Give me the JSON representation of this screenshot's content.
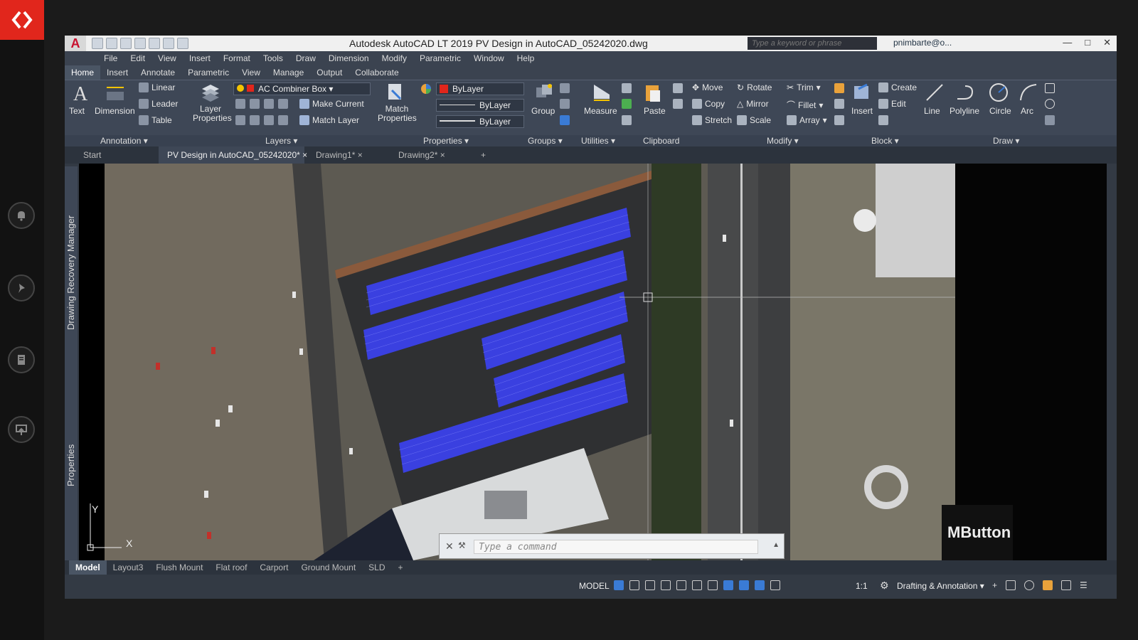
{
  "window": {
    "title": "Autodesk AutoCAD LT 2019    PV Design in AutoCAD_05242020.dwg",
    "search_placeholder": "Type a keyword or phrase",
    "user": "pnimbarte@o...",
    "app_badge": "A"
  },
  "menu": [
    "File",
    "Edit",
    "View",
    "Insert",
    "Format",
    "Tools",
    "Draw",
    "Dimension",
    "Modify",
    "Parametric",
    "Window",
    "Help"
  ],
  "ribbon_tabs": [
    "Home",
    "Insert",
    "Annotate",
    "Parametric",
    "View",
    "Manage",
    "Output",
    "Collaborate"
  ],
  "annotation": {
    "text": "Text",
    "dimension": "Dimension",
    "linear": "Linear",
    "leader": "Leader",
    "table": "Table",
    "title": "Annotation"
  },
  "layers": {
    "layer_properties": "Layer Properties",
    "current_layer": "AC Combiner Box",
    "make_current": "Make Current",
    "match_layer": "Match Layer",
    "title": "Layers"
  },
  "properties": {
    "match_properties": "Match Properties",
    "color": "ByLayer",
    "linetype": "ByLayer",
    "lineweight": "ByLayer",
    "title": "Properties"
  },
  "groups": {
    "group": "Group",
    "title": "Groups"
  },
  "utilities": {
    "measure": "Measure",
    "title": "Utilities"
  },
  "clipboard": {
    "paste": "Paste",
    "title": "Clipboard"
  },
  "modify": {
    "move": "Move",
    "rotate": "Rotate",
    "trim": "Trim",
    "copy": "Copy",
    "mirror": "Mirror",
    "fillet": "Fillet",
    "stretch": "Stretch",
    "scale": "Scale",
    "array": "Array",
    "title": "Modify"
  },
  "block": {
    "insert": "Insert",
    "create": "Create",
    "edit": "Edit",
    "title": "Block"
  },
  "draw": {
    "line": "Line",
    "polyline": "Polyline",
    "circle": "Circle",
    "arc": "Arc",
    "title": "Draw"
  },
  "doc_tabs": [
    "Start",
    "PV Design in AutoCAD_05242020*",
    "Drawing1*",
    "Drawing2*"
  ],
  "side_palettes": {
    "recovery": "Drawing Recovery Manager",
    "properties": "Properties"
  },
  "ucs": {
    "x": "X",
    "y": "Y"
  },
  "command_line": {
    "placeholder": "Type a command"
  },
  "overlay": {
    "mbutton": "MButton"
  },
  "layout_tabs": [
    "Model",
    "Layout3",
    "Flush Mount",
    "Flat roof",
    "Carport",
    "Ground Mount",
    "SLD"
  ],
  "status": {
    "model": "MODEL",
    "scale": "1:1",
    "workspace": "Drafting & Annotation"
  },
  "colors": {
    "accent_red": "#e1261c",
    "panel_blue": "#3a40e0",
    "ribbon_bg": "#3e4756"
  }
}
